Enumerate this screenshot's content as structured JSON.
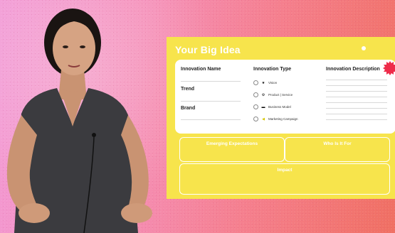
{
  "slide": {
    "title": "Your Big Idea",
    "logo_text": "",
    "columns": {
      "innovation_name": "Innovation Name",
      "innovation_type": "Innovation Type",
      "innovation_description": "Innovation Description"
    },
    "fields": {
      "trend": "Trend",
      "brand": "Brand"
    },
    "types": [
      {
        "label": "Vision",
        "icon": "star-icon",
        "color": "#000000"
      },
      {
        "label": "Product | Service",
        "icon": "gear-icon",
        "color": "#000000"
      },
      {
        "label": "Business Model",
        "icon": "chart-icon",
        "color": "#111111"
      },
      {
        "label": "Marketing Campaign",
        "icon": "megaphone-icon",
        "color": "#d4c400"
      }
    ],
    "boxes": {
      "emerging_expectations": "Emerging Expectations",
      "who_is_it_for": "Who Is It For",
      "impact": "Impact"
    },
    "colors": {
      "slide": "#f7e44c",
      "accent_seal": "#ee2c4a"
    }
  }
}
